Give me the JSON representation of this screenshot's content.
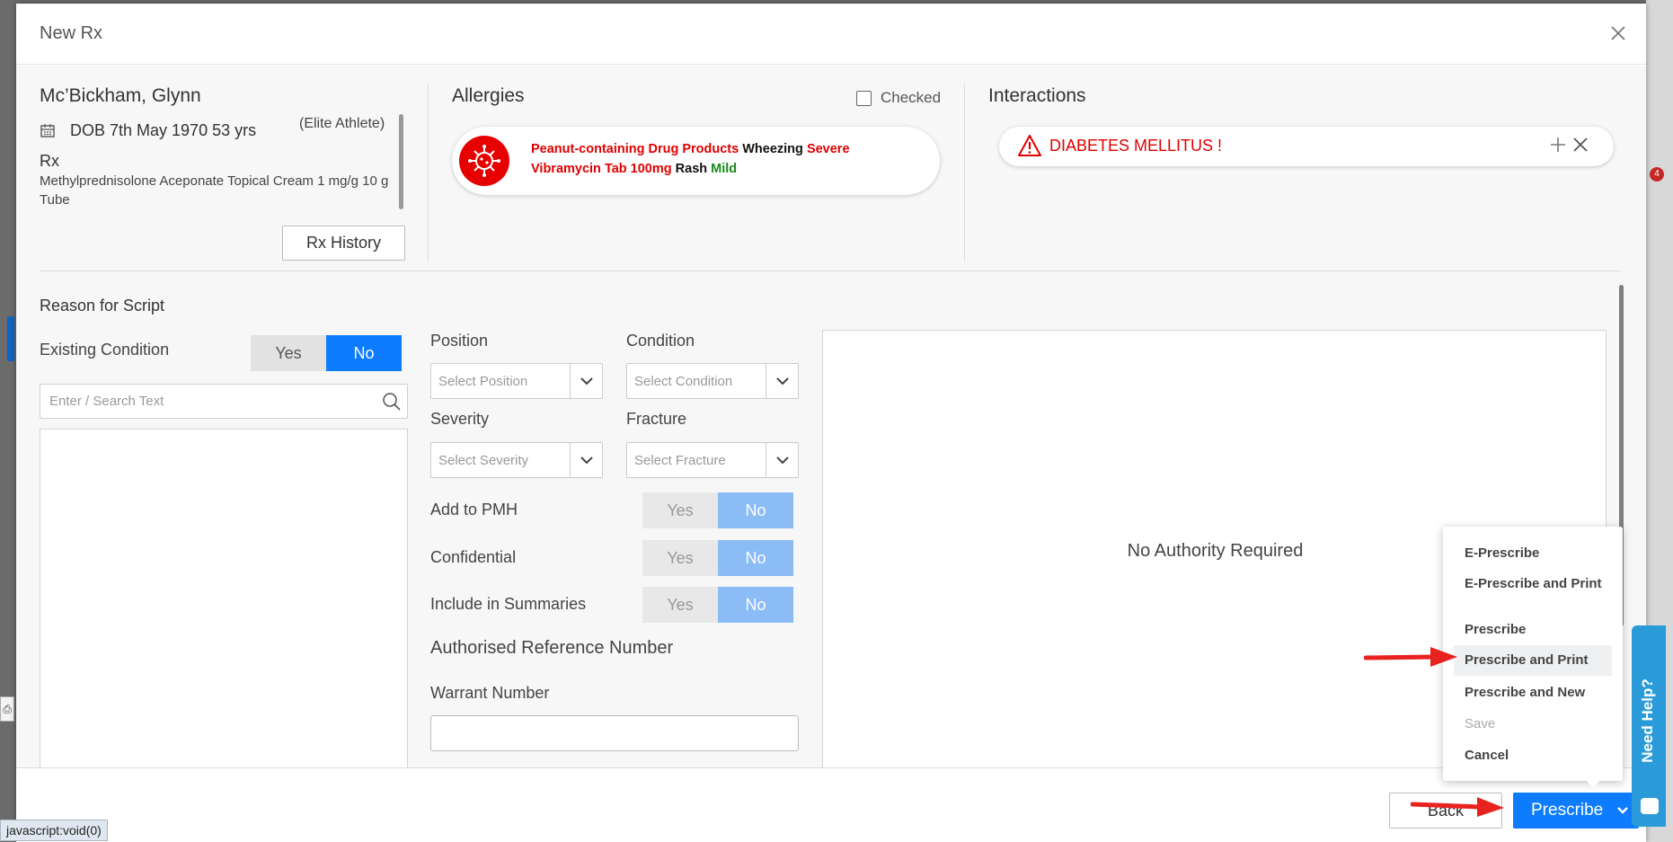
{
  "modal": {
    "title": "New Rx"
  },
  "patient": {
    "name": "Mc’Bickham, Glynn",
    "dob": "DOB 7th May 1970 53 yrs",
    "tag": "(Elite Athlete)",
    "rx_label": "Rx",
    "rx_medication": "Methylprednisolone Aceponate Topical Cream 1 mg/g 10 g Tube",
    "rx_history_label": "Rx History"
  },
  "allergies": {
    "title": "Allergies",
    "checked_label": "Checked",
    "items": [
      {
        "substance": "Peanut-containing Drug Products",
        "reaction": "Wheezing",
        "severity": "Severe"
      },
      {
        "substance": "Vibramycin Tab 100mg",
        "reaction": "Rash",
        "severity": "Mild"
      }
    ]
  },
  "interactions": {
    "title": "Interactions",
    "items": [
      {
        "text": "DIABETES MELLITUS !"
      }
    ]
  },
  "reason": {
    "title": "Reason for Script",
    "existing_condition": {
      "label": "Existing Condition",
      "yes": "Yes",
      "no": "No",
      "selected": "No"
    },
    "search_placeholder": "Enter / Search Text"
  },
  "fields": {
    "position": {
      "label": "Position",
      "placeholder": "Select Position"
    },
    "condition": {
      "label": "Condition",
      "placeholder": "Select Condition"
    },
    "severity": {
      "label": "Severity",
      "placeholder": "Select Severity"
    },
    "fracture": {
      "label": "Fracture",
      "placeholder": "Select Fracture"
    },
    "add_to_pmh": {
      "label": "Add to PMH",
      "yes": "Yes",
      "no": "No"
    },
    "confidential": {
      "label": "Confidential",
      "yes": "Yes",
      "no": "No"
    },
    "include_in_summaries": {
      "label": "Include in Summaries",
      "yes": "Yes",
      "no": "No"
    },
    "authorised_reference_number": "Authorised Reference Number",
    "warrant_number": {
      "label": "Warrant Number",
      "value": ""
    }
  },
  "authority": {
    "text": "No Authority Required"
  },
  "menu": {
    "items": [
      {
        "label": "E-Prescribe"
      },
      {
        "label": "E-Prescribe and Print"
      },
      {
        "label": "Prescribe"
      },
      {
        "label": "Prescribe and Print"
      },
      {
        "label": "Prescribe and New"
      },
      {
        "label": "Save"
      },
      {
        "label": "Cancel"
      }
    ]
  },
  "footer": {
    "back_label": "Back",
    "prescribe_label": "Prescribe"
  },
  "need_help": "Need Help?",
  "status_bar": "javascript:void(0)",
  "background": {
    "badge": "4"
  },
  "colors": {
    "primary": "#0d7cff",
    "danger": "#e00000",
    "mild": "#1a8a1a",
    "help": "#2a9bd8"
  }
}
